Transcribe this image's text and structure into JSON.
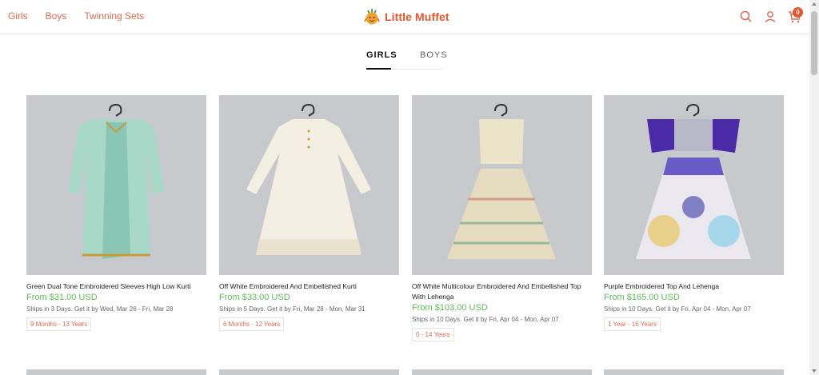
{
  "header": {
    "nav": [
      "Girls",
      "Boys",
      "Twinning Sets"
    ],
    "brand": "Little Muffet",
    "icons": [
      "search-icon",
      "account-icon",
      "cart-icon"
    ],
    "cart_count": "0",
    "colors": {
      "accent": "#e4572e",
      "link": "#e0684f",
      "price": "#5cbf54"
    }
  },
  "tabs": [
    {
      "label": "GIRLS",
      "active": true
    },
    {
      "label": "BOYS",
      "active": false
    }
  ],
  "products": [
    {
      "title": "Green Dual Tone Embroidered Sleeves High Low Kurti",
      "price": "From $31.00 USD",
      "shipping": "Ships in 3 Days. Get it by Wed, Mar 26 - Fri, Mar 28",
      "age": "9 Months - 13 Years"
    },
    {
      "title": "Off White Embroidered And Embellished Kurti",
      "price": "From $33.00 USD",
      "shipping": "Ships in 5 Days. Get it by Fri, Mar 28 - Mon, Mar 31",
      "age": "6 Months - 12 Years"
    },
    {
      "title": "Off White Multicolour Embroidered And Embellished Top With Lehenga",
      "price": "From $103.00 USD",
      "shipping": "Ships in 10 Days. Get it by Fri, Apr 04 - Mon, Apr 07",
      "age": "0 - 14 Years"
    },
    {
      "title": "Purple Embroidered Top And Lehenga",
      "price": "From $165.00 USD",
      "shipping": "Ships in 10 Days. Get it by Fri, Apr 04 - Mon, Apr 07",
      "age": "1 Year - 16 Years"
    }
  ]
}
